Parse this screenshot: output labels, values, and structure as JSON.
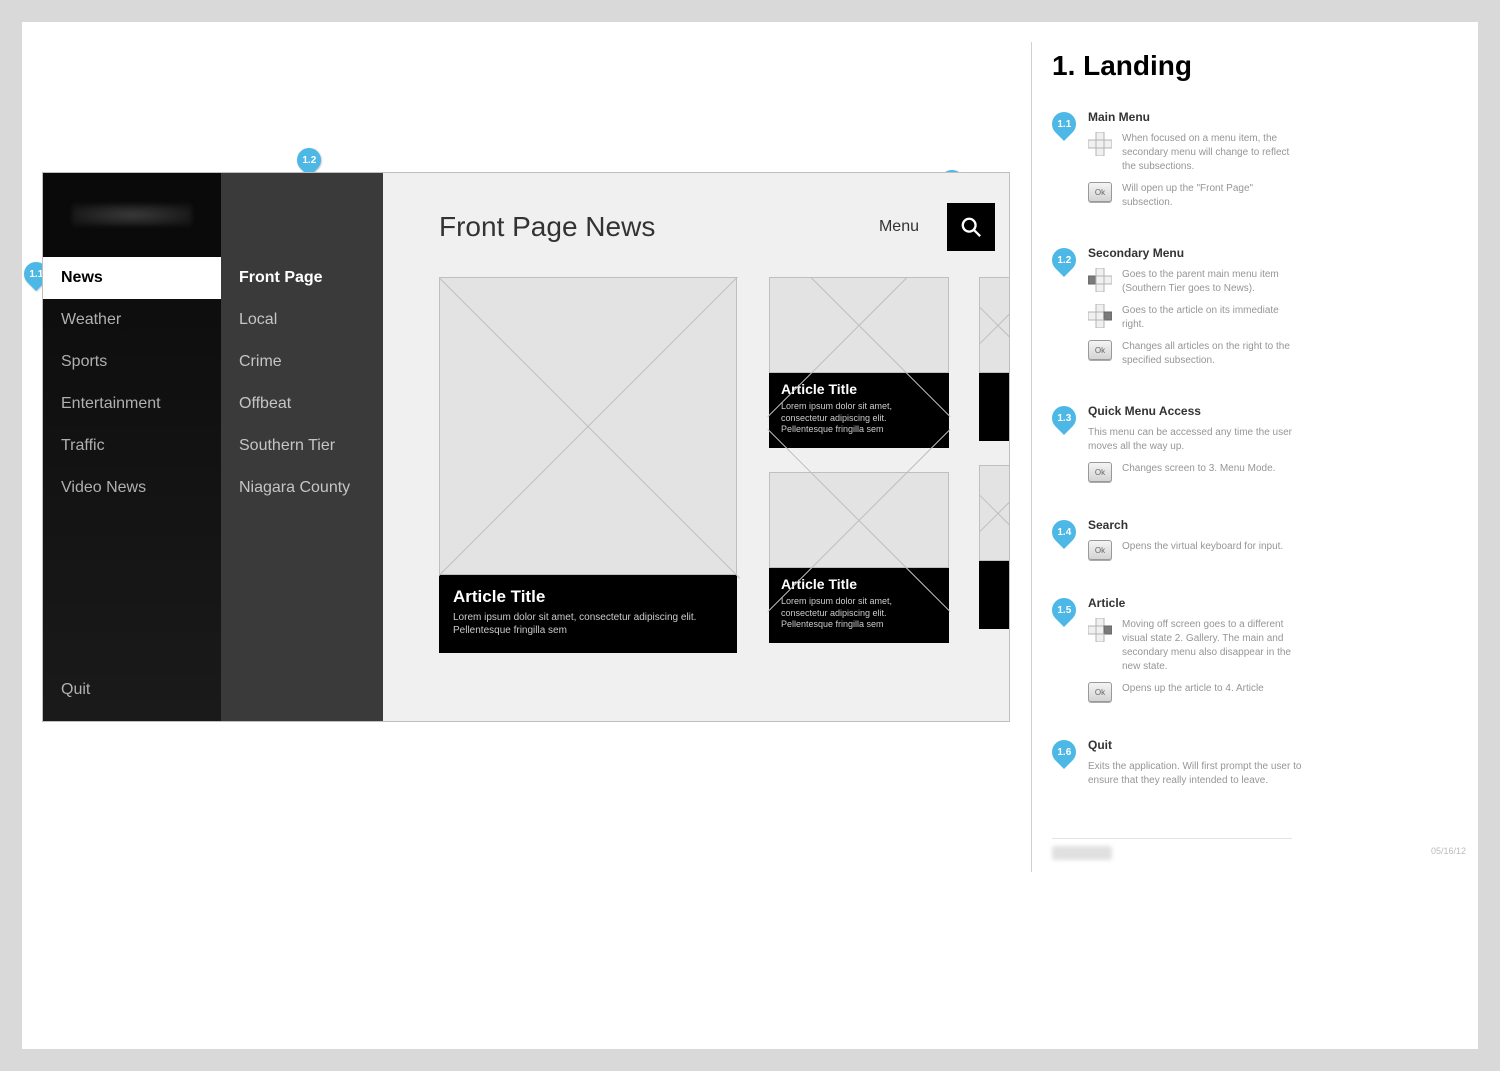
{
  "main_menu": {
    "items": [
      "News",
      "Weather",
      "Sports",
      "Entertainment",
      "Traffic",
      "Video News"
    ],
    "active_index": 0,
    "quit_label": "Quit"
  },
  "secondary_menu": {
    "items": [
      "Front Page",
      "Local",
      "Crime",
      "Offbeat",
      "Southern Tier",
      "Niagara County"
    ],
    "active_index": 0
  },
  "content": {
    "title": "Front Page News",
    "menu_label": "Menu",
    "lead_article": {
      "title": "Article Title",
      "summary": "Lorem ipsum dolor sit amet, consectetur adipiscing elit. Pellentesque fringilla sem"
    },
    "side_articles": [
      {
        "title": "Article Title",
        "summary": "Lorem ipsum dolor sit amet, consectetur adipiscing elit. Pellentesque fringilla sem"
      },
      {
        "title": "Article Title",
        "summary": "Lorem ipsum dolor sit amet, consectetur adipiscing elit. Pellentesque fringilla sem"
      }
    ]
  },
  "markers": {
    "m11": "1.1",
    "m12": "1.2",
    "m13": "1.3",
    "m14": "1.4",
    "m15": "1.5",
    "m16": "1.6"
  },
  "notes": {
    "title": "1. Landing",
    "items": [
      {
        "num": "1.1",
        "title": "Main Menu",
        "rows": [
          {
            "icon": "dpad-all",
            "text": "When focused on a menu item, the secondary menu will change to reflect the subsections."
          },
          {
            "icon": "ok",
            "text": "Will open up the \"Front Page\" subsection."
          }
        ]
      },
      {
        "num": "1.2",
        "title": "Secondary Menu",
        "rows": [
          {
            "icon": "dpad-left",
            "text": "Goes to the parent main menu item (Southern Tier goes to News)."
          },
          {
            "icon": "dpad-right",
            "text": "Goes to the article on its immediate right."
          },
          {
            "icon": "ok",
            "text": "Changes all articles on the right to the specified subsection."
          }
        ]
      },
      {
        "num": "1.3",
        "title": "Quick Menu Access",
        "desc": "This menu can be accessed any time the user moves all the way up.",
        "rows": [
          {
            "icon": "ok",
            "text": "Changes screen to 3. Menu Mode."
          }
        ]
      },
      {
        "num": "1.4",
        "title": "Search",
        "rows": [
          {
            "icon": "ok",
            "text": "Opens the virtual keyboard for input."
          }
        ]
      },
      {
        "num": "1.5",
        "title": "Article",
        "rows": [
          {
            "icon": "dpad-right",
            "text": "Moving off screen goes to a different visual state 2. Gallery. The main and secondary menu also disappear in the new state."
          },
          {
            "icon": "ok",
            "text": "Opens up the article to 4. Article"
          }
        ]
      },
      {
        "num": "1.6",
        "title": "Quit",
        "desc": "Exits the application. Will first prompt the user to ensure that they really intended to leave."
      }
    ]
  },
  "footer_date": "05/16/12"
}
